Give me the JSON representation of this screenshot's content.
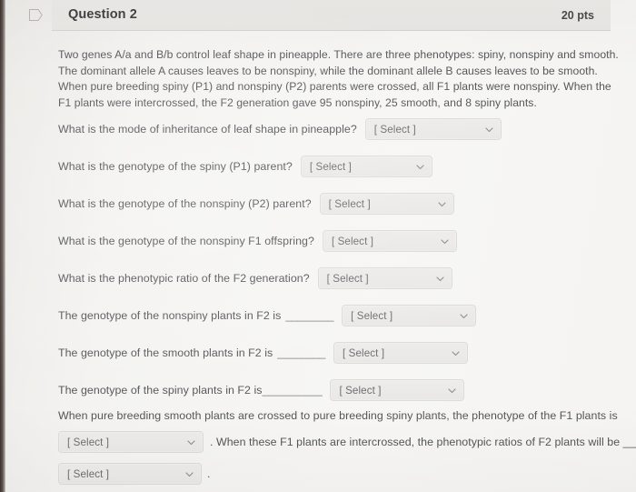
{
  "header": {
    "title": "Question 2",
    "points": "20 pts",
    "icon": "tag-icon"
  },
  "body": {
    "paragraph": "Two genes A/a and B/b control leaf shape in pineapple. There are three phenotypes: spiny, nonspiny and smooth. The dominant allele A causes leaves to be nonspiny, while the dominant allele B causes leaves to be smooth. When pure breeding spiny (P1) and nonspiny (P2) parents were crossed, all F1 plants were nonspiny.  When the F1 plants were intercrossed, the F2 generation gave 95 nonspiny, 25 smooth, and 8 spiny plants."
  },
  "select_placeholder": "[ Select ]",
  "questions": [
    {
      "label": "What is the mode of inheritance of leaf shape in pineapple?",
      "blank": "",
      "value": "[ Select ]"
    },
    {
      "label": "What is the genotype of the spiny (P1) parent?",
      "blank": "",
      "value": "[ Select ]"
    },
    {
      "label": "What is the genotype of the nonspiny (P2) parent?",
      "blank": "",
      "value": "[ Select ]"
    },
    {
      "label": "What is the genotype of the nonspiny F1 offspring?",
      "blank": "",
      "value": "[ Select ]"
    },
    {
      "label": "What is the phenotypic ratio of the F2 generation?",
      "blank": "",
      "value": "[ Select ]"
    },
    {
      "label": "The genotype of the nonspiny plants in F2 is",
      "blank": "________",
      "value": "[ Select ]"
    },
    {
      "label": "The genotype of the smooth plants in F2 is",
      "blank": "________",
      "value": "[ Select ]"
    },
    {
      "label": "The genotype of the spiny plants in F2 is",
      "blank": "__________",
      "value": "[ Select ]"
    }
  ],
  "tail": {
    "line1": "When pure breeding smooth plants are crossed to pure breeding spiny plants, the phenotype of the F1 plants is",
    "select1": "[ Select ]",
    "after1": ". When these F1 plants are intercrossed, the phenotypic ratios of F2 plants will be ______",
    "select2": "[ Select ]",
    "after2": "."
  },
  "colors": {
    "page_background": "#f4f3f1",
    "header_background": "#eceae7",
    "select_background": "#ebeae8",
    "select_border": "#dddbd8",
    "text": "#55555a",
    "title": "#3d3d3d"
  }
}
